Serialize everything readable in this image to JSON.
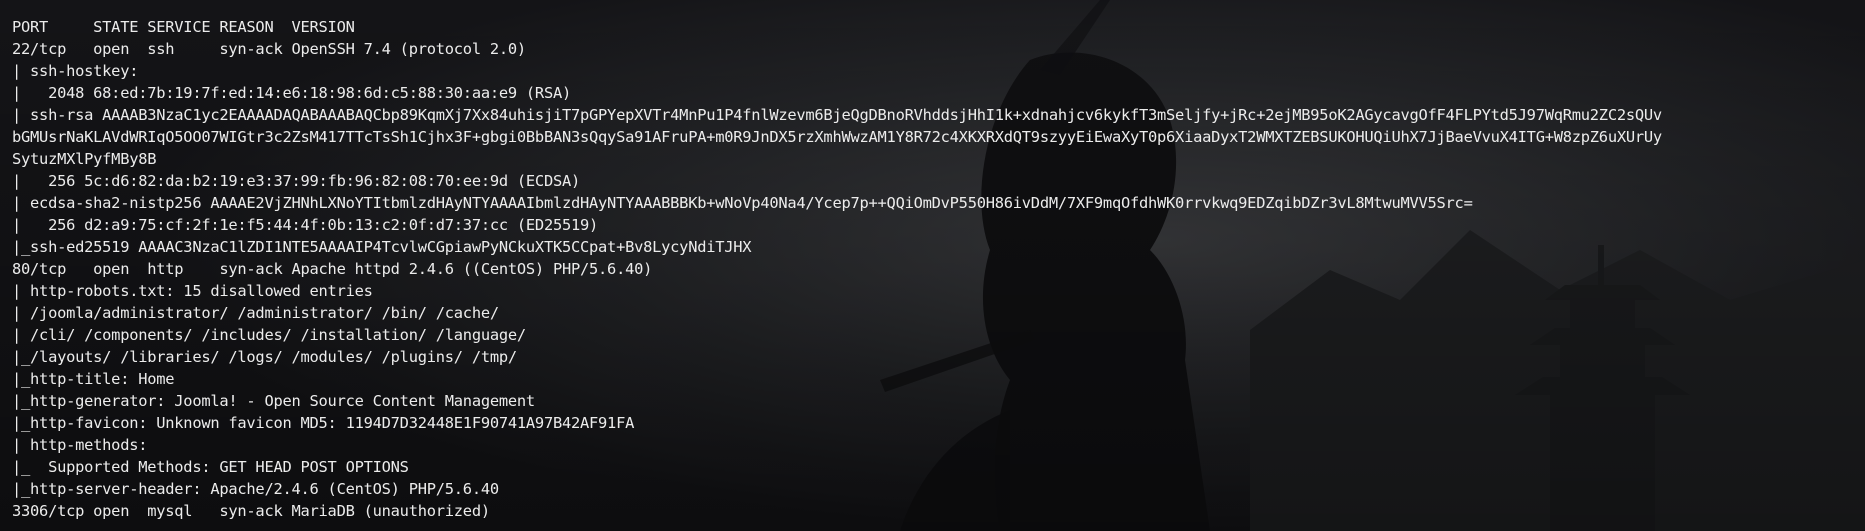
{
  "theme": {
    "background": "#17171a",
    "foreground": "#ececec"
  },
  "terminal": {
    "lines": [
      "PORT     STATE SERVICE REASON  VERSION",
      "22/tcp   open  ssh     syn-ack OpenSSH 7.4 (protocol 2.0)",
      "| ssh-hostkey: ",
      "|   2048 68:ed:7b:19:7f:ed:14:e6:18:98:6d:c5:88:30:aa:e9 (RSA)",
      "| ssh-rsa AAAAB3NzaC1yc2EAAAADAQABAAABAQCbp89KqmXj7Xx84uhisjiT7pGPYepXVTr4MnPu1P4fnlWzevm6BjeQgDBnoRVhddsjHhI1k+xdnahjcv6kykfT3mSeljfy+jRc+2ejMB95oK2AGycavgOfF4FLPYtd5J97WqRmu2ZC2sQUv",
      "bGMUsrNaKLAVdWRIqO5OO07WIGtr3c2ZsM417TTcTsSh1Cjhx3F+gbgi0BbBAN3sQqySa91AFruPA+m0R9JnDX5rzXmhWwzAM1Y8R72c4XKXRXdQT9szyyEiEwaXyT0p6XiaaDyxT2WMXTZEBSUKOHUQiUhX7JjBaeVvuX4ITG+W8zpZ6uXUrUy",
      "SytuzMXlPyfMBy8B",
      "|   256 5c:d6:82:da:b2:19:e3:37:99:fb:96:82:08:70:ee:9d (ECDSA)",
      "| ecdsa-sha2-nistp256 AAAAE2VjZHNhLXNoYTItbmlzdHAyNTYAAAAIbmlzdHAyNTYAAABBBKb+wNoVp40Na4/Ycep7p++QQiOmDvP550H86ivDdM/7XF9mqOfdhWK0rrvkwq9EDZqibDZr3vL8MtwuMVV5Src=",
      "|   256 d2:a9:75:cf:2f:1e:f5:44:4f:0b:13:c2:0f:d7:37:cc (ED25519)",
      "|_ssh-ed25519 AAAAC3NzaC1lZDI1NTE5AAAAIP4TcvlwCGpiawPyNCkuXTK5CCpat+Bv8LycyNdiTJHX",
      "80/tcp   open  http    syn-ack Apache httpd 2.4.6 ((CentOS) PHP/5.6.40)",
      "| http-robots.txt: 15 disallowed entries ",
      "| /joomla/administrator/ /administrator/ /bin/ /cache/ ",
      "| /cli/ /components/ /includes/ /installation/ /language/ ",
      "|_/layouts/ /libraries/ /logs/ /modules/ /plugins/ /tmp/",
      "|_http-title: Home",
      "|_http-generator: Joomla! - Open Source Content Management",
      "|_http-favicon: Unknown favicon MD5: 1194D7D32448E1F90741A97B42AF91FA",
      "| http-methods: ",
      "|_  Supported Methods: GET HEAD POST OPTIONS",
      "|_http-server-header: Apache/2.4.6 (CentOS) PHP/5.6.40",
      "3306/tcp open  mysql   syn-ack MariaDB (unauthorized)"
    ]
  }
}
